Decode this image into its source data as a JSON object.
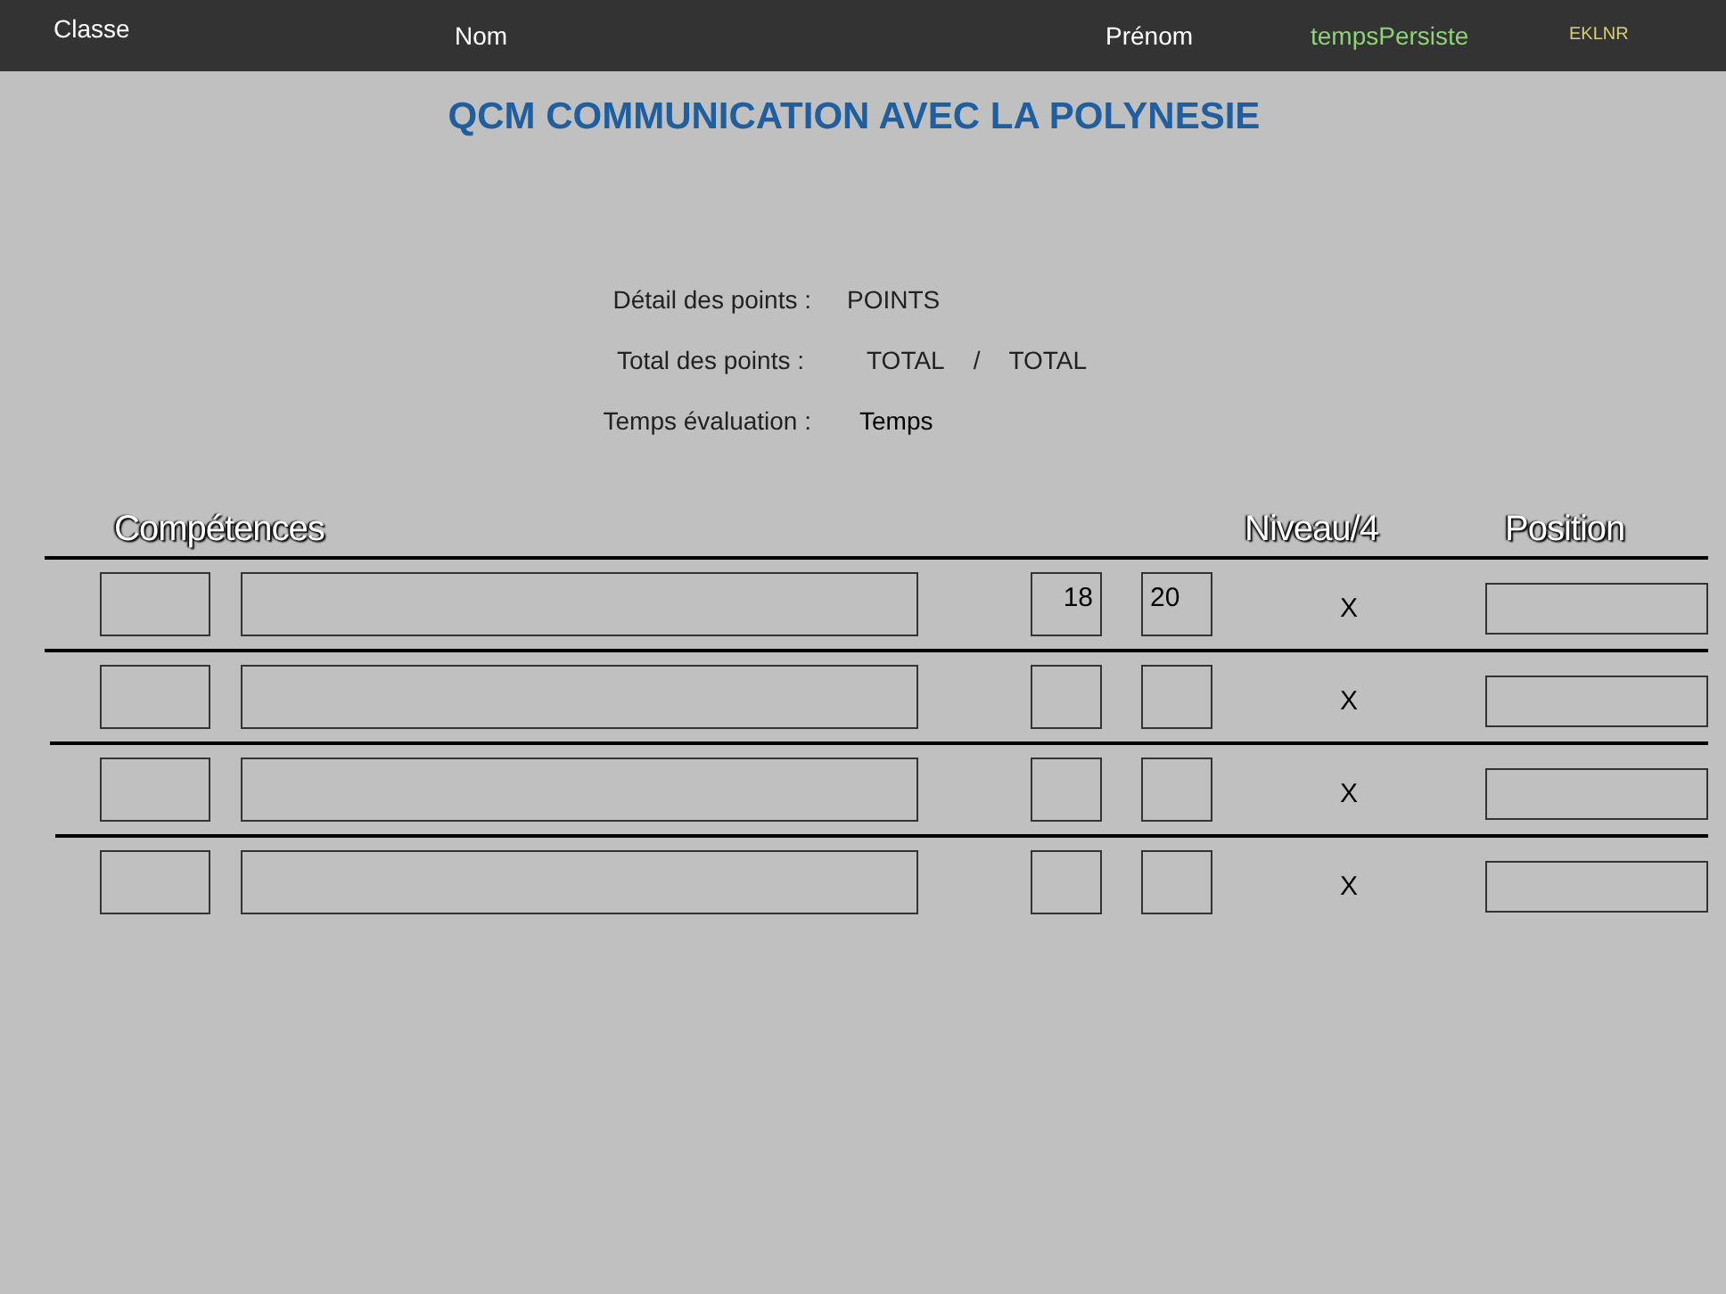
{
  "header": {
    "class_label": "Classe",
    "name_label": "Nom",
    "first_name_label": "Prénom",
    "timer": "tempsPersiste",
    "code": "EKLNR"
  },
  "title": "QCM COMMUNICATION AVEC LA POLYNESIE",
  "summary": {
    "detail_label": "Détail des points :",
    "detail_value": "POINTS",
    "total_label": "Total des points :",
    "total_value": "TOTAL",
    "separator": "/",
    "total_max": "TOTAL",
    "time_label": "Temps évaluation :",
    "time_value": "Temps"
  },
  "table": {
    "columns": [
      "Compétences",
      "Niveau/4",
      "Position"
    ],
    "rows": [
      {
        "score": "18",
        "max": "20",
        "level": "X"
      },
      {
        "level": "X"
      },
      {
        "level": "X"
      },
      {
        "level": "X"
      }
    ]
  }
}
